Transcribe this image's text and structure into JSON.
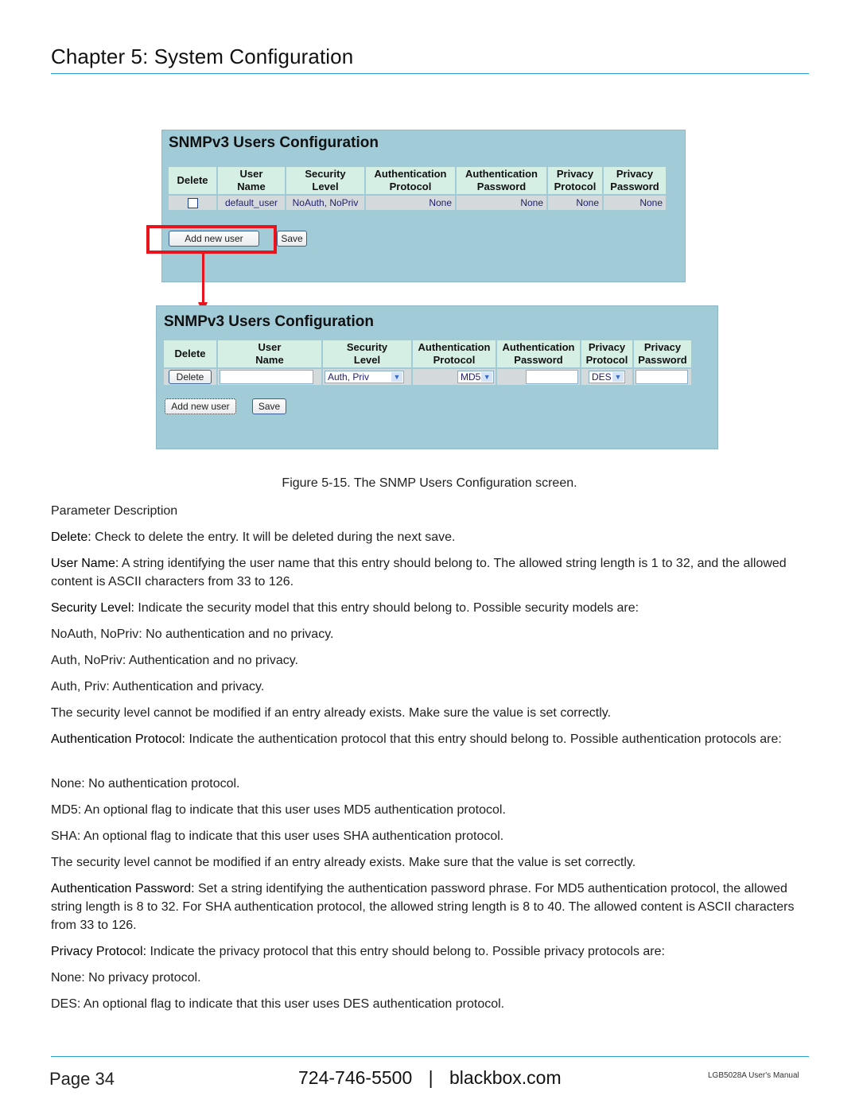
{
  "header": {
    "chapter_title": "Chapter 5: System Configuration"
  },
  "figure": {
    "panel_before": {
      "title": "SNMPv3 Users Configuration",
      "columns": [
        [
          "Delete",
          ""
        ],
        [
          "User",
          "Name"
        ],
        [
          "Security",
          "Level"
        ],
        [
          "Authentication",
          "Protocol"
        ],
        [
          "Authentication",
          "Password"
        ],
        [
          "Privacy",
          "Protocol"
        ],
        [
          "Privacy",
          "Password"
        ]
      ],
      "row": {
        "delete_checked": false,
        "user_name": "default_user",
        "security_level": "NoAuth, NoPriv",
        "auth_protocol": "None",
        "auth_password": "None",
        "privacy_protocol": "None",
        "privacy_password": "None"
      },
      "add_button": "Add new user",
      "save_button": "Save"
    },
    "panel_after": {
      "title": "SNMPv3 Users Configuration",
      "columns": [
        [
          "Delete",
          ""
        ],
        [
          "User",
          "Name"
        ],
        [
          "Security",
          "Level"
        ],
        [
          "Authentication",
          "Protocol"
        ],
        [
          "Authentication",
          "Password"
        ],
        [
          "Privacy",
          "Protocol"
        ],
        [
          "Privacy",
          "Password"
        ]
      ],
      "row": {
        "delete_button": "Delete",
        "user_name": "",
        "security_level": "Auth, Priv",
        "auth_protocol": "MD5",
        "auth_password": "",
        "privacy_protocol": "DES",
        "privacy_password": ""
      },
      "add_button": "Add new user",
      "save_button": "Save"
    },
    "annotation_color": "#e8131b",
    "caption": "Figure 5-15. The SNMP Users Configuration screen."
  },
  "content": {
    "param_heading": "Parameter Description",
    "paragraphs": [
      {
        "label": "Delete:",
        "text": " Check to delete the entry. It will be deleted during the next save."
      },
      {
        "label": "User Name:",
        "text": " A string identifying the user name that this entry should belong to. The allowed string length is 1 to 32, and the allowed content is ASCII characters from 33 to 126."
      },
      {
        "label": "Security Level:",
        "text": " Indicate the security model that this entry should belong to. Possible security models are:"
      },
      {
        "label": "",
        "text": "NoAuth, NoPriv: No authentication and no privacy."
      },
      {
        "label": "",
        "text": "Auth, NoPriv: Authentication and no privacy."
      },
      {
        "label": "",
        "text": "Auth, Priv: Authentication and privacy."
      },
      {
        "label": "",
        "text": "The security level cannot be modified if an entry already exists. Make sure the value is set correctly."
      },
      {
        "label": "Authentication Protocol:",
        "text": " Indicate the authentication protocol that this entry should belong to. Possible authentication protocols are:"
      },
      {
        "label": "",
        "text": "None: No authentication protocol."
      },
      {
        "label": "",
        "text": "MD5: An optional flag to indicate that this user uses MD5 authentication protocol."
      },
      {
        "label": "",
        "text": "SHA: An optional flag to indicate that this user uses SHA authentication protocol."
      },
      {
        "label": "",
        "text": "The security level cannot be modified if an entry already exists. Make sure that the value is set correctly."
      },
      {
        "label": "Authentication Password:",
        "text": " Set a string identifying the authentication password phrase. For MD5 authentication protocol, the allowed string length is 8 to 32. For SHA authentication protocol, the allowed string length is 8 to 40. The allowed content is ASCII characters from 33 to 126."
      },
      {
        "label": "Privacy Protocol:",
        "text": " Indicate the privacy protocol that this entry should belong to. Possible privacy protocols are:"
      },
      {
        "label": "",
        "text": "None: No privacy protocol."
      },
      {
        "label": "",
        "text": "DES: An optional flag to indicate that this user uses DES authentication protocol."
      }
    ]
  },
  "footer": {
    "page": "Page 34",
    "phone": "724-746-5500",
    "separator": "|",
    "website": "blackbox.com",
    "manual": "LGB5028A User's Manual"
  },
  "colors": {
    "accent_rule": "#2aa1cf",
    "panel_bg": "#a2cbd8",
    "table_header_bg": "#d5efe5",
    "table_cell_bg": "#d4dadc"
  }
}
